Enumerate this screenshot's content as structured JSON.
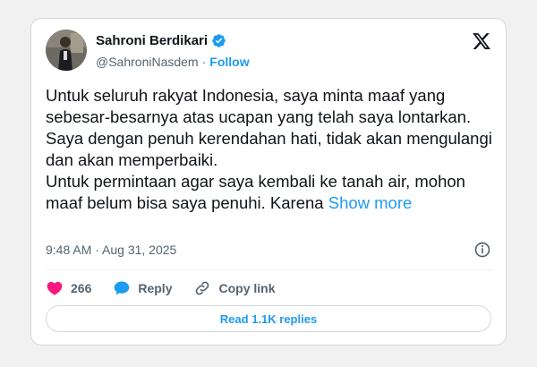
{
  "tweet": {
    "author": {
      "name": "Sahroni Berdikari",
      "handle": "@SahroniNasdem",
      "separator": "·",
      "follow_label": "Follow"
    },
    "text": "Untuk seluruh rakyat Indonesia, saya minta maaf yang sebesar-besarnya atas ucapan yang telah saya lontarkan. Saya dengan penuh kerendahan hati, tidak akan mengulangi dan akan memperbaiki.\nUntuk permintaan agar saya kembali ke tanah air, mohon maaf belum bisa saya penuhi. Karena",
    "show_more_label": "Show more",
    "timestamp": "9:48 AM · Aug 31, 2025",
    "actions": {
      "likes_count": "266",
      "reply_label": "Reply",
      "copy_link_label": "Copy link"
    },
    "read_replies_label": "Read 1.1K replies"
  },
  "colors": {
    "accent": "#1d9bf0",
    "like": "#f91880",
    "text": "#0f1419",
    "muted": "#536471"
  },
  "icons": {
    "verified": "verified-badge-icon",
    "x_logo": "x-logo-icon",
    "info": "info-icon",
    "like": "heart-icon",
    "reply": "speech-bubble-icon",
    "copy_link": "link-icon"
  }
}
